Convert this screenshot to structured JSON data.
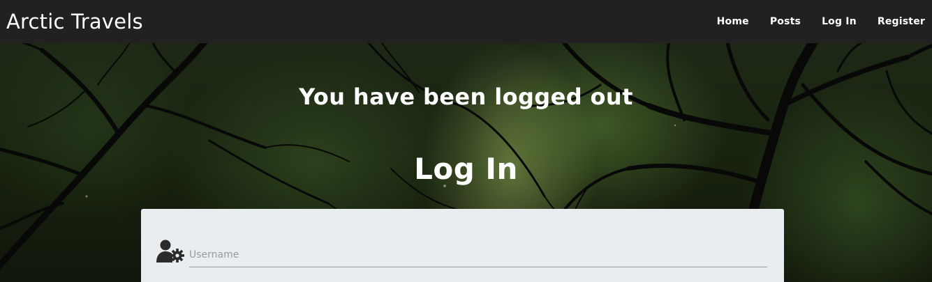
{
  "navbar": {
    "brand": "Arctic Travels",
    "links": [
      {
        "label": "Home"
      },
      {
        "label": "Posts"
      },
      {
        "label": "Log In"
      },
      {
        "label": "Register"
      }
    ]
  },
  "hero": {
    "message": "You have been logged out",
    "title": "Log In"
  },
  "login_form": {
    "username": {
      "icon": "user-cog-icon",
      "placeholder": "Username",
      "value": ""
    }
  },
  "colors": {
    "navbar_bg": "#212121",
    "card_bg": "#e9edf0",
    "text_light": "#ffffff"
  }
}
